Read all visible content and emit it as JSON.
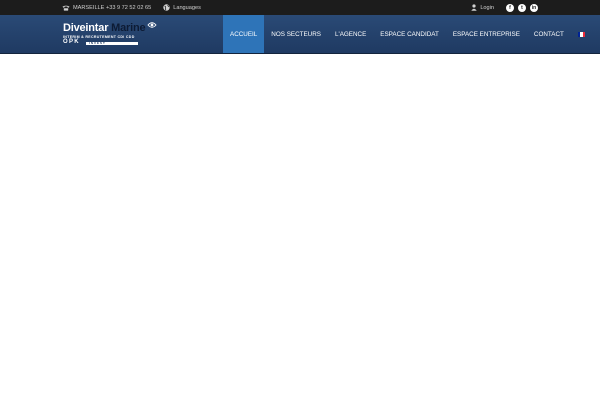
{
  "topbar": {
    "phone_text": "MARSEILLE +33 9 72 52 02 65",
    "languages_label": "Languages",
    "login_label": "Login",
    "social": [
      {
        "name": "facebook",
        "glyph": "f"
      },
      {
        "name": "twitter",
        "glyph": "t"
      },
      {
        "name": "linkedin",
        "glyph": "in"
      }
    ]
  },
  "logo": {
    "name_part1": "Diveintar",
    "name_part2": "Marine",
    "tagline": "INTERIM & RECRUTEMENT CDI CDD",
    "sub": "OPK",
    "sub_bar": "INVEST"
  },
  "nav": {
    "items": [
      "ACCUEIL",
      "NOS SECTEURS",
      "L'AGENCE",
      "ESPACE CANDIDAT",
      "ESPACE ENTREPRISE",
      "CONTACT"
    ],
    "active_index": 0,
    "language_flag": "fr-flag-icon"
  },
  "colors": {
    "topbar_bg": "#1c1c1c",
    "header_bg": "#24426d",
    "active_tab": "#2e74b8",
    "flag_blue": "#002395",
    "flag_white": "#ffffff",
    "flag_red": "#ed2939"
  }
}
